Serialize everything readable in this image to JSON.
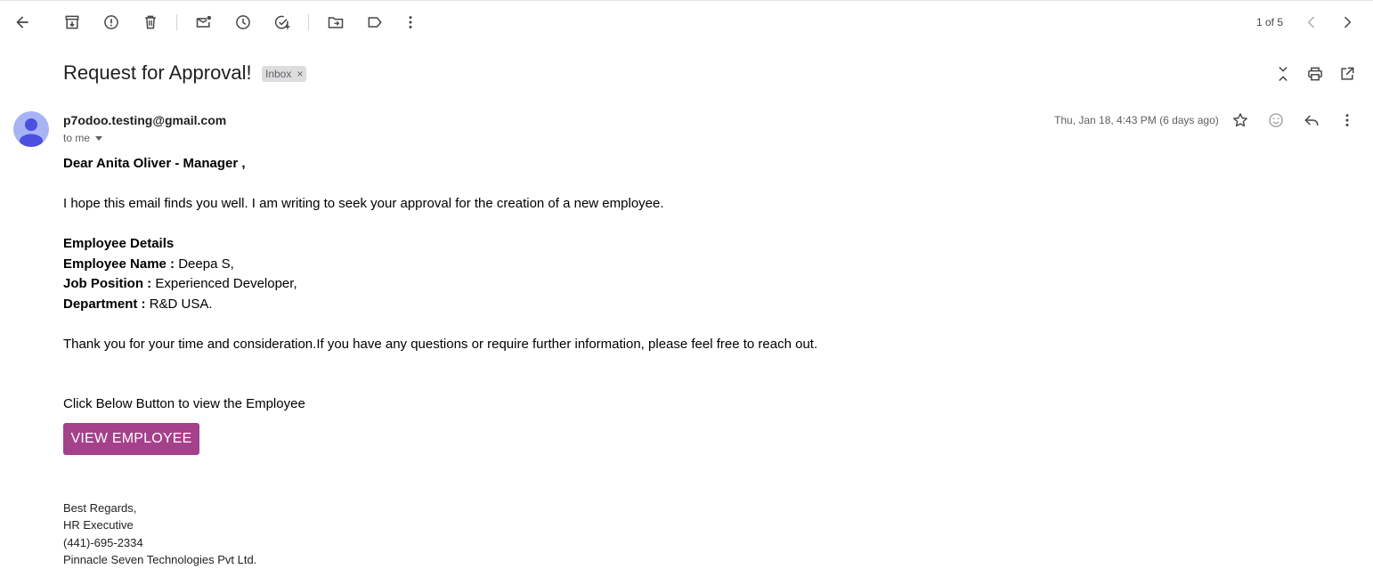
{
  "toolbar": {
    "icons": [
      "back-icon",
      "archive-icon",
      "report-spam-icon",
      "delete-icon",
      "mark-unread-icon",
      "snooze-icon",
      "add-task-icon",
      "move-to-icon",
      "label-icon",
      "more-vert-icon"
    ],
    "pager": "1 of 5"
  },
  "subject": {
    "title": "Request for Approval!",
    "label_chip": "Inbox",
    "chip_close": "×"
  },
  "message": {
    "sender": "p7odoo.testing@gmail.com",
    "recipient": "to me",
    "date": "Thu, Jan 18, 4:43 PM (6 days ago)"
  },
  "email_body": {
    "greeting": "Dear Anita Oliver - Manager ,",
    "intro": "I hope this email finds you well. I am writing to seek your approval for the creation of a new employee.",
    "details_heading": "Employee Details",
    "fields": [
      {
        "label": "Employee Name :",
        "value": "Deepa S,"
      },
      {
        "label": "Job Position :",
        "value": "Experienced Developer,"
      },
      {
        "label": "Department :",
        "value": "R&D USA."
      }
    ],
    "thanks": "Thank you for your time and consideration.If you have any questions or require further information, please feel free to reach out.",
    "cta_text": "Click Below Button to view the Employee",
    "button_label": "VIEW EMPLOYEE",
    "button_color": "#a5408b",
    "signature": [
      "Best Regards,",
      "HR Executive",
      "(441)-695-2334",
      "Pinnacle Seven Technologies Pvt Ltd."
    ]
  }
}
